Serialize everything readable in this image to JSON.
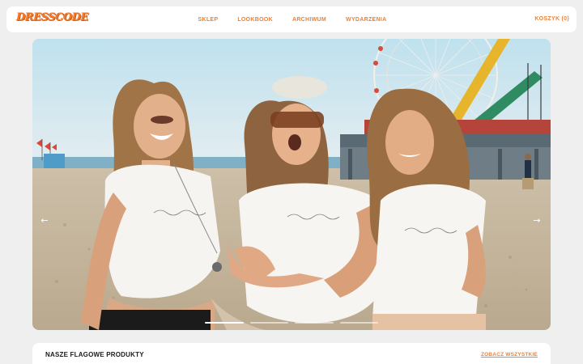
{
  "brand": {
    "logo_text": "DRESSCODE",
    "accent": "#e8823c"
  },
  "nav": {
    "links": [
      {
        "label": "SKLEP"
      },
      {
        "label": "LOOKBOOK"
      },
      {
        "label": "ARCHIWUM"
      },
      {
        "label": "WYDARZENIA"
      }
    ],
    "cart_label": "KOSZYK (0)"
  },
  "hero": {
    "prev_icon": "arrow-left-icon",
    "next_icon": "arrow-right-icon",
    "prev_glyph": "←",
    "next_glyph": "→",
    "slide_count": 4,
    "active_slide": 1,
    "image_alt": "Three women in white t-shirts laughing on a beach with a pier and ferris wheel behind them"
  },
  "featured": {
    "title": "NASZE FLAGOWE PRODUKTY",
    "see_all_label": "ZOBACZ WSZYSTKIE"
  }
}
